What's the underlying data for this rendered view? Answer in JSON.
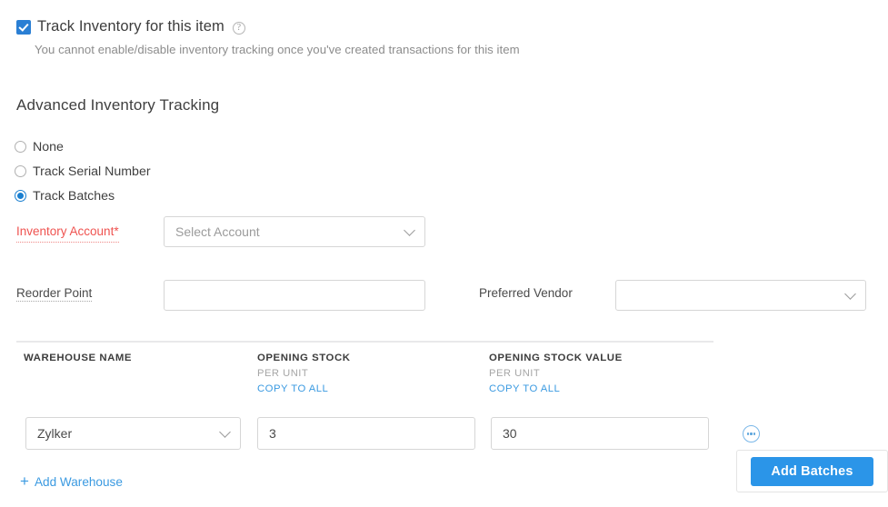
{
  "colors": {
    "accent_blue": "#2b95e8",
    "link_blue": "#3b9ae1",
    "required_red": "#ef5350",
    "text": "#3c3c3c",
    "muted": "#8c8c8c"
  },
  "track_inventory": {
    "checkbox_checked": true,
    "label": "Track Inventory for this item",
    "help_icon": "help-circle-icon",
    "note": "You cannot enable/disable inventory tracking once you've created transactions for this item"
  },
  "advanced_section": {
    "title": "Advanced Inventory Tracking",
    "options": [
      {
        "label": "None",
        "selected": false
      },
      {
        "label": "Track Serial Number",
        "selected": false
      },
      {
        "label": "Track Batches",
        "selected": true
      }
    ]
  },
  "fields": {
    "inventory_account": {
      "label": "Inventory Account*",
      "required": true,
      "placeholder": "Select Account",
      "value": "",
      "caret_icon": "chevron-down-icon"
    },
    "reorder_point": {
      "label": "Reorder Point",
      "value": "",
      "placeholder": ""
    },
    "preferred_vendor": {
      "label": "Preferred Vendor",
      "value": "",
      "placeholder": "",
      "caret_icon": "chevron-down-icon"
    }
  },
  "table": {
    "columns": [
      {
        "title": "WAREHOUSE NAME",
        "sub": "",
        "link": ""
      },
      {
        "title": "OPENING STOCK",
        "sub": "PER UNIT",
        "link": "COPY TO ALL"
      },
      {
        "title": "OPENING STOCK VALUE",
        "sub": "PER UNIT",
        "link": "COPY TO ALL"
      }
    ],
    "rows": [
      {
        "warehouse": "Zylker",
        "opening_stock": "3",
        "opening_stock_value": "30",
        "row_menu_icon": "more-options-icon"
      }
    ],
    "add_warehouse": {
      "icon": "plus-icon",
      "label": "Add Warehouse"
    }
  },
  "actions": {
    "add_batches_label": "Add Batches"
  }
}
